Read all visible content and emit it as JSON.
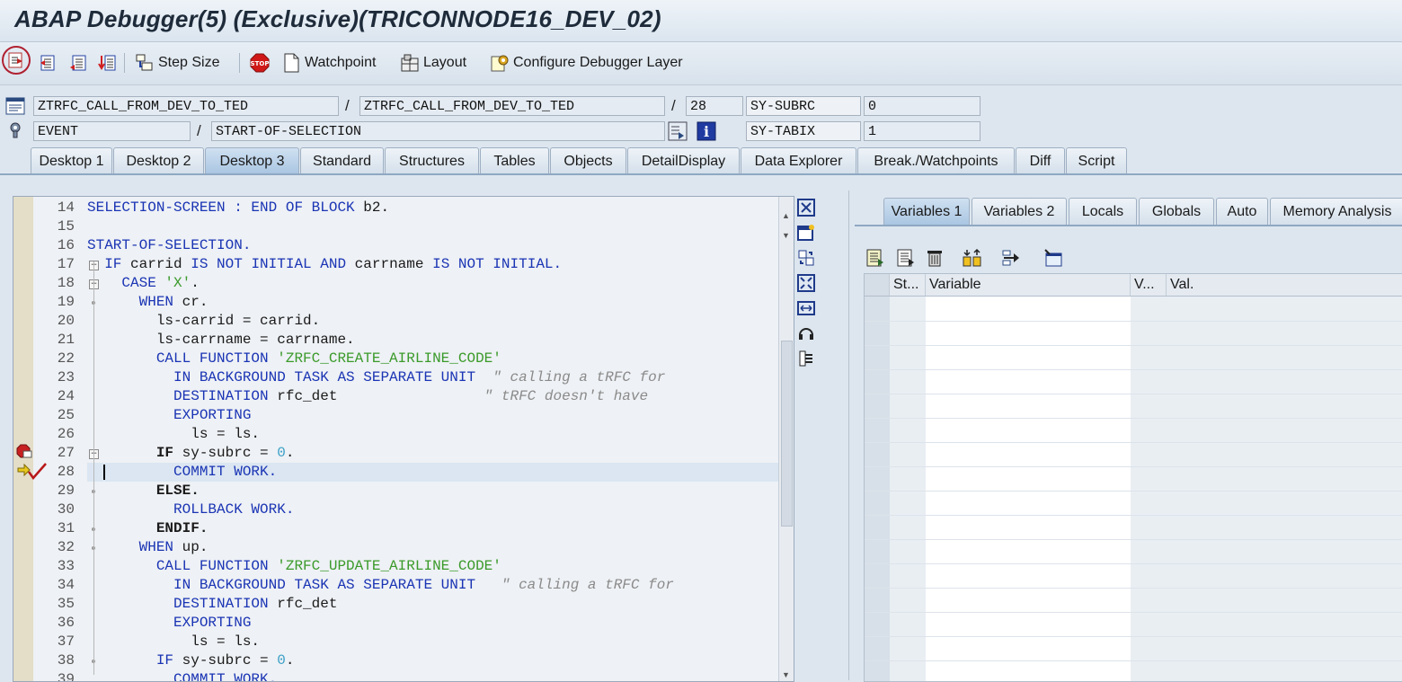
{
  "window": {
    "title": "ABAP Debugger(5)  (Exclusive)(TRICONNODE16_DEV_02)"
  },
  "toolbar": {
    "step_size": "Step Size",
    "watchpoint": "Watchpoint",
    "layout": "Layout",
    "configure": "Configure Debugger Layer"
  },
  "info": {
    "program": "ZTRFC_CALL_FROM_DEV_TO_TED",
    "include": "ZTRFC_CALL_FROM_DEV_TO_TED",
    "line": "28",
    "subrc_label": "SY-SUBRC",
    "subrc_value": "0",
    "event_type": "EVENT",
    "event_name": "START-OF-SELECTION",
    "tabix_label": "SY-TABIX",
    "tabix_value": "1",
    "separator": "/"
  },
  "tabs": [
    "Desktop 1",
    "Desktop 2",
    "Desktop 3",
    "Standard",
    "Structures",
    "Tables",
    "Objects",
    "DetailDisplay",
    "Data Explorer",
    "Break./Watchpoints",
    "Diff",
    "Script"
  ],
  "active_tab": "Desktop 3",
  "code": {
    "line_numbers": [
      "14",
      "15",
      "16",
      "17",
      "18",
      "19",
      "20",
      "21",
      "22",
      "23",
      "24",
      "25",
      "26",
      "27",
      "28",
      "29",
      "30",
      "31",
      "32",
      "33",
      "34",
      "35",
      "36",
      "37",
      "38",
      "39"
    ],
    "lines": [
      [
        [
          "kw",
          "SELECTION-SCREEN : END OF BLOCK "
        ],
        [
          "plain",
          "b2."
        ]
      ],
      [],
      [
        [
          "kw",
          "START-OF-SELECTION."
        ]
      ],
      [
        [
          "plain",
          "  "
        ],
        [
          "kw",
          "IF "
        ],
        [
          "plain",
          "carrid "
        ],
        [
          "kw",
          "IS NOT INITIAL AND "
        ],
        [
          "plain",
          "carrname "
        ],
        [
          "kw",
          "IS NOT INITIAL."
        ]
      ],
      [
        [
          "plain",
          "    "
        ],
        [
          "kw",
          "CASE "
        ],
        [
          "str",
          "'X'"
        ],
        [
          "plain",
          "."
        ]
      ],
      [
        [
          "plain",
          "      "
        ],
        [
          "kw",
          "WHEN "
        ],
        [
          "plain",
          "cr."
        ]
      ],
      [
        [
          "plain",
          "        ls-carrid = carrid."
        ]
      ],
      [
        [
          "plain",
          "        ls-carrname = carrname."
        ]
      ],
      [
        [
          "plain",
          "        "
        ],
        [
          "kw",
          "CALL FUNCTION "
        ],
        [
          "str",
          "'ZRFC_CREATE_AIRLINE_CODE'"
        ]
      ],
      [
        [
          "plain",
          "          "
        ],
        [
          "kw",
          "IN BACKGROUND TASK AS SEPARATE UNIT  "
        ],
        [
          "cmt",
          "\" calling a tRFC for"
        ]
      ],
      [
        [
          "plain",
          "          "
        ],
        [
          "kw",
          "DESTINATION "
        ],
        [
          "plain",
          "rfc_det                 "
        ],
        [
          "cmt",
          "\" tRFC doesn't have"
        ]
      ],
      [
        [
          "plain",
          "          "
        ],
        [
          "kw",
          "EXPORTING"
        ]
      ],
      [
        [
          "plain",
          "            ls = ls."
        ]
      ],
      [
        [
          "plain",
          "        "
        ],
        [
          "bold",
          "IF "
        ],
        [
          "plain",
          "sy-subrc = "
        ],
        [
          "num",
          "0"
        ],
        [
          "plain",
          "."
        ]
      ],
      [
        [
          "plain",
          "          "
        ],
        [
          "kw",
          "COMMIT WORK."
        ]
      ],
      [
        [
          "plain",
          "        "
        ],
        [
          "bold",
          "ELSE."
        ]
      ],
      [
        [
          "plain",
          "          "
        ],
        [
          "kw",
          "ROLLBACK WORK."
        ]
      ],
      [
        [
          "plain",
          "        "
        ],
        [
          "bold",
          "ENDIF."
        ]
      ],
      [
        [
          "plain",
          "      "
        ],
        [
          "kw",
          "WHEN "
        ],
        [
          "plain",
          "up."
        ]
      ],
      [
        [
          "plain",
          "        "
        ],
        [
          "kw",
          "CALL FUNCTION "
        ],
        [
          "str",
          "'ZRFC_UPDATE_AIRLINE_CODE'"
        ]
      ],
      [
        [
          "plain",
          "          "
        ],
        [
          "kw",
          "IN BACKGROUND TASK AS SEPARATE UNIT   "
        ],
        [
          "cmt",
          "\" calling a tRFC for"
        ]
      ],
      [
        [
          "plain",
          "          "
        ],
        [
          "kw",
          "DESTINATION "
        ],
        [
          "plain",
          "rfc_det"
        ]
      ],
      [
        [
          "plain",
          "          "
        ],
        [
          "kw",
          "EXPORTING"
        ]
      ],
      [
        [
          "plain",
          "            ls = ls."
        ]
      ],
      [
        [
          "plain",
          "        "
        ],
        [
          "kw",
          "IF "
        ],
        [
          "plain",
          "sy-subrc = "
        ],
        [
          "num",
          "0"
        ],
        [
          "plain",
          "."
        ]
      ],
      [
        [
          "plain",
          "          "
        ],
        [
          "kw",
          "COMMIT WORK."
        ]
      ]
    ]
  },
  "vars": {
    "tabs": [
      "Variables 1",
      "Variables 2",
      "Locals",
      "Globals",
      "Auto",
      "Memory Analysis"
    ],
    "active_tab": "Variables 1",
    "columns": [
      "St...",
      "Variable",
      "V...",
      "Val."
    ]
  }
}
